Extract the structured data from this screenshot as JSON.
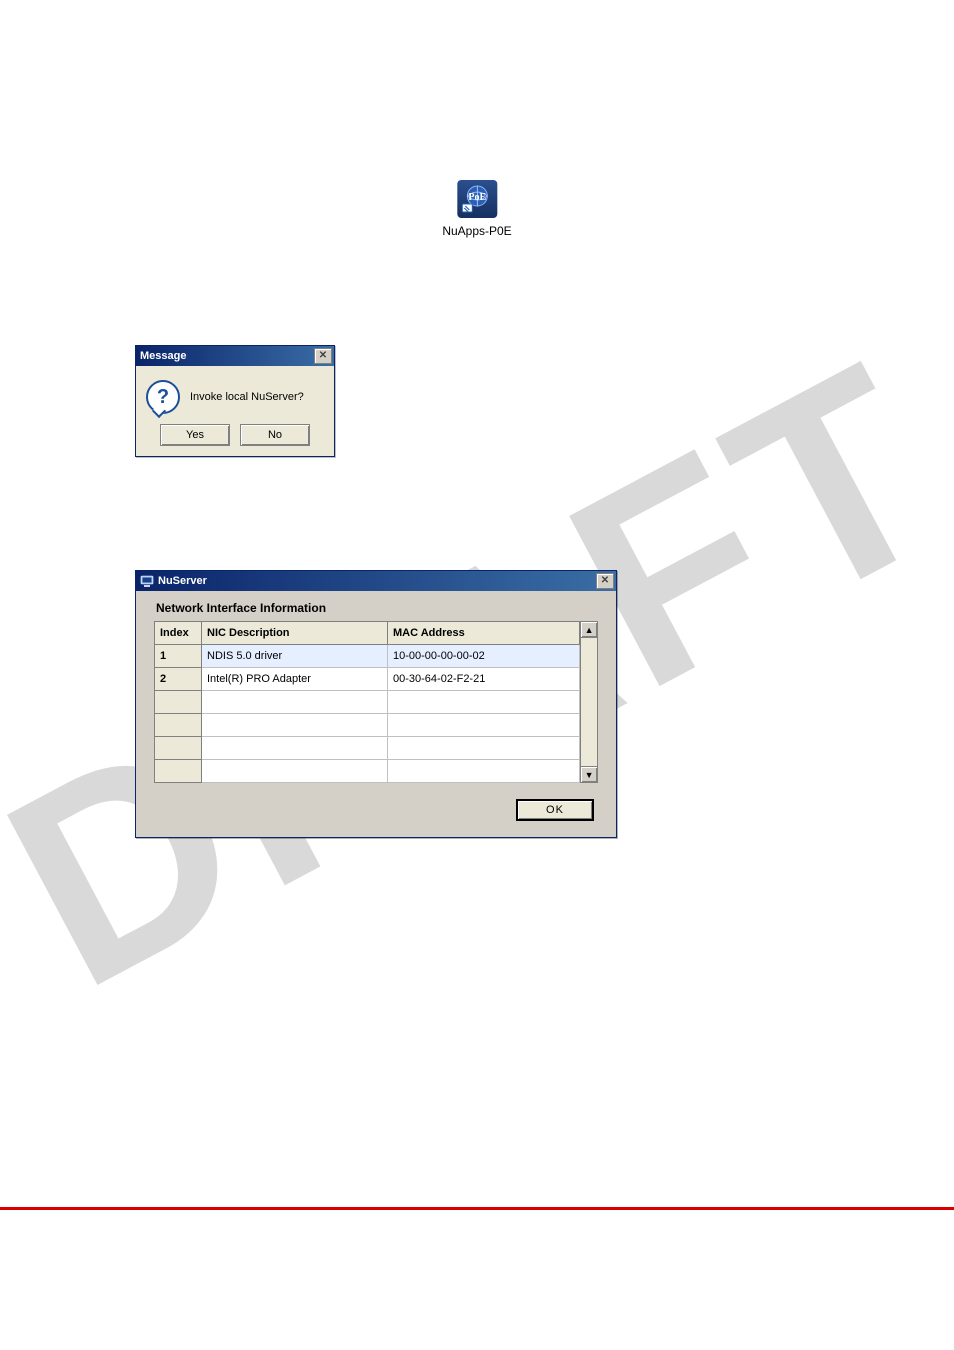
{
  "desktop_icon": {
    "label": "NuApps-P0E",
    "badge": "PoE"
  },
  "message_dialog": {
    "title": "Message",
    "text": "Invoke local NuServer?",
    "yes_label": "Yes",
    "no_label": "No"
  },
  "nuserver_dialog": {
    "title": "NuServer",
    "heading": "Network Interface Information",
    "columns": {
      "index": "Index",
      "nic": "NIC Description",
      "mac": "MAC Address"
    },
    "rows": [
      {
        "index": "1",
        "nic": "NDIS 5.0 driver",
        "mac": "10-00-00-00-00-02",
        "selected": true
      },
      {
        "index": "2",
        "nic": "Intel(R) PRO Adapter",
        "mac": "00-30-64-02-F2-21",
        "selected": false
      },
      {
        "index": "",
        "nic": "",
        "mac": "",
        "selected": false
      },
      {
        "index": "",
        "nic": "",
        "mac": "",
        "selected": false
      },
      {
        "index": "",
        "nic": "",
        "mac": "",
        "selected": false
      },
      {
        "index": "",
        "nic": "",
        "mac": "",
        "selected": false
      }
    ],
    "ok_label": "OK"
  },
  "watermark": "DRAFT"
}
